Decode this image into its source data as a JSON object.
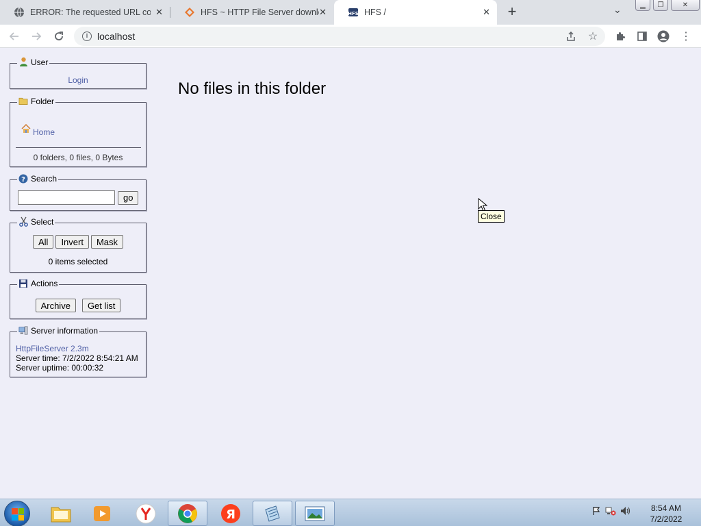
{
  "browser": {
    "tabs": [
      {
        "title": "ERROR: The requested URL could not be retrieved",
        "icon": "globe-icon",
        "active": false
      },
      {
        "title": "HFS ~ HTTP File Server download",
        "icon": "hfs-diamond-icon",
        "active": false
      },
      {
        "title": "HFS /",
        "icon": "hfs-logo-icon",
        "active": true
      }
    ],
    "address": "localhost"
  },
  "page": {
    "user": {
      "legend": "User",
      "login": "Login"
    },
    "folder": {
      "legend": "Folder",
      "home": "Home",
      "stats": "0 folders, 0 files, 0 Bytes"
    },
    "search": {
      "legend": "Search",
      "value": "",
      "go": "go"
    },
    "select": {
      "legend": "Select",
      "all": "All",
      "invert": "Invert",
      "mask": "Mask",
      "status": "0 items selected"
    },
    "actions": {
      "legend": "Actions",
      "archive": "Archive",
      "get_list": "Get list"
    },
    "server": {
      "legend": "Server information",
      "version": "HttpFileServer 2.3m",
      "time": "Server time: 7/2/2022 8:54:21 AM",
      "uptime": "Server uptime: 00:00:32"
    },
    "message": "No files in this folder",
    "tooltip": "Close"
  },
  "taskbar": {
    "clock_time": "8:54 AM",
    "clock_date": "7/2/2022",
    "apps": [
      "file-explorer",
      "media-player",
      "yandex-browser",
      "chrome",
      "yandex",
      "notepad",
      "image-viewer"
    ]
  },
  "colors": {
    "page_bg": "#eeeef8",
    "link": "#4f5fa6"
  }
}
